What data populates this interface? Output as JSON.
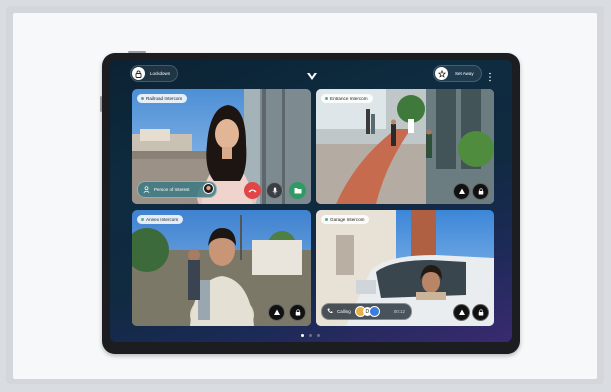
{
  "topbar": {
    "lockdown_label": "Lockdown",
    "set_away_label": "Set Away",
    "logo": "verkada-chevron-logo",
    "more_icon": "more-vertical-icon"
  },
  "tiles": {
    "railroad": {
      "label": "Railroad Intercom",
      "person_label": "Person of Interest"
    },
    "entrance": {
      "label": "Entrance Intercom"
    },
    "annex": {
      "label": "Annex Intercom"
    },
    "garage": {
      "label": "Garage Intercom",
      "calling_label": "Calling",
      "calling_badge": "D",
      "calling_time": "00:12"
    }
  },
  "pagination": {
    "pages": 3,
    "current": 1
  },
  "colors": {
    "end_call": "#e04646",
    "accept_call": "#2f9a63",
    "accent": "#3c7dd9"
  }
}
